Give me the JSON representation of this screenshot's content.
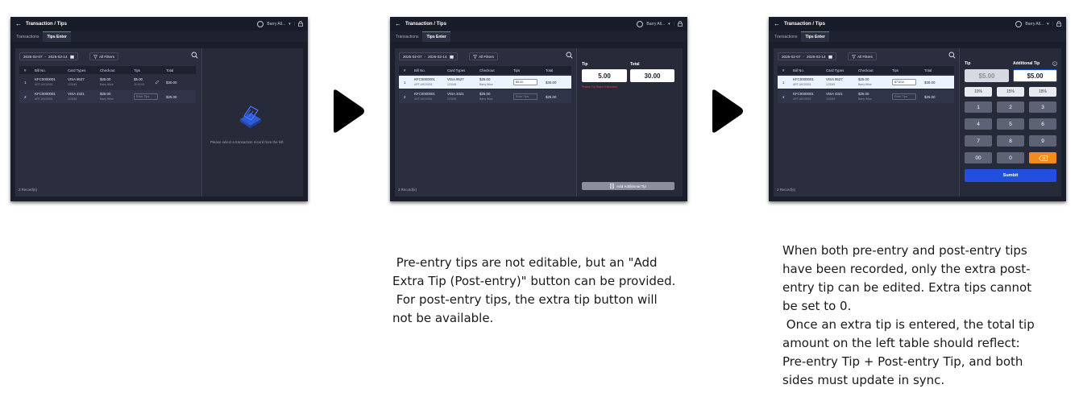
{
  "colors": {
    "accent": "#2150e0",
    "selected_row": "#ebf3ff",
    "error": "#e04545",
    "delete_key": "#f28c20",
    "frame_bg": "#1b1f2c"
  },
  "screens": [
    {
      "title": "Transaction / Tips",
      "user": "Barry All...",
      "tabs": [
        "Transactions",
        "Tips Enter"
      ],
      "date_from": "2025-02-07",
      "date_sep": "-",
      "date_to": "2025-02-14",
      "filter_label": "All Filters",
      "columns": [
        "#",
        "Bill No.",
        "Card Types",
        "Checkout",
        "Tips",
        "Total"
      ],
      "rows": [
        {
          "num": "1",
          "bill": "KFC0000001",
          "bill_sub": "ART-UKO0001",
          "card": "VISA 9527",
          "card_sub": "123245",
          "checkout": "$25.00",
          "checkout_sub": "Barry Wise",
          "tips": "$5.00",
          "tips_sub": "20:00.00",
          "tips_placeholder": "",
          "total": "$30.00"
        },
        {
          "num": "2",
          "bill": "KFC0000001",
          "bill_sub": "ART-UKO0001",
          "card": "VISA 4321",
          "card_sub": "123245",
          "checkout": "$25.00",
          "checkout_sub": "Barry Wise",
          "tips": "",
          "tips_sub": "",
          "tips_placeholder": "Enter Tips",
          "total": "$25.00"
        }
      ],
      "records": "2 Record(s)",
      "placeholder": "Please select a transaction record from the left",
      "icons": [
        "back-arrow-icon",
        "user-icon",
        "chevron-down-icon",
        "lock-icon",
        "calendar-icon",
        "filter-icon",
        "search-icon",
        "edit-icon",
        "empty-box-icon"
      ]
    },
    {
      "title": "Transaction / Tips",
      "user": "Barry All...",
      "tabs": [
        "Transactions",
        "Tips Enter"
      ],
      "date_from": "2025-02-07",
      "date_sep": "-",
      "date_to": "2025-02-14",
      "filter_label": "All Filters",
      "columns": [
        "#",
        "Bill No.",
        "Card Types",
        "Checkout",
        "Tips",
        "Total"
      ],
      "rows": [
        {
          "num": "1",
          "bill": "KFC0000001",
          "bill_sub": "ART-UKO0001",
          "card": "VISA 9527",
          "card_sub": "123245",
          "checkout": "$25.00",
          "checkout_sub": "Barry Wise",
          "tips": "$5.00",
          "tips_placeholder": "",
          "total": "$30.00"
        },
        {
          "num": "2",
          "bill": "KFC0000001",
          "bill_sub": "ART-UKO0001",
          "card": "VISA 4321",
          "card_sub": "123245",
          "checkout": "$25.00",
          "checkout_sub": "Barry Wise",
          "tips": "",
          "tips_placeholder": "Enter Tips",
          "total": "$25.00"
        }
      ],
      "records": "2 Record(s)",
      "tip_label": "Tip",
      "total_label": "Total",
      "tip_value": "5.00",
      "total_value": "30.00",
      "error_text": "Please Tip Warm Estimates",
      "add_tip_label": "Add Additional Tip",
      "icons": [
        "document-plus-icon"
      ]
    },
    {
      "title": "Transaction / Tips",
      "user": "Barry All...",
      "tabs": [
        "Transactions",
        "Tips Enter"
      ],
      "date_from": "2025-02-07",
      "date_sep": "-",
      "date_to": "2025-02-14",
      "filter_label": "All Filters",
      "columns": [
        "#",
        "Bill No.",
        "Card Types",
        "Checkout",
        "Tips",
        "Total"
      ],
      "rows": [
        {
          "num": "1",
          "bill": "KFC0000001",
          "bill_sub": "ART-UKO0001",
          "card": "VISA 9527",
          "card_sub": "123245",
          "checkout": "$25.00",
          "checkout_sub": "Barry Wise",
          "tips": "$7.5/10",
          "tips_placeholder": "",
          "total": "$30.00"
        },
        {
          "num": "2",
          "bill": "KFC0000001",
          "bill_sub": "ART-UKO0001",
          "card": "VISA 4321",
          "card_sub": "123245",
          "checkout": "$25.00",
          "checkout_sub": "Barry Wise",
          "tips": "",
          "tips_placeholder": "Enter Tips",
          "total": "$25.00"
        }
      ],
      "records": "2 Record(s)",
      "tip_label": "Tip",
      "additional_tip_label": "Additional Tip",
      "tip_value": "$5.00",
      "additional_tip_value": "$5.00",
      "percent_buttons": [
        "10%",
        "15%",
        "18%"
      ],
      "keys": [
        "1",
        "2",
        "3",
        "4",
        "5",
        "6",
        "7",
        "8",
        "9",
        "00",
        "0"
      ],
      "submit_label": "Sumbit",
      "icons": [
        "info-icon",
        "backspace-icon"
      ]
    }
  ],
  "captions": {
    "middle": " Pre-entry tips are not editable, but an \"Add\nExtra Tip (Post-entry)\" button can be provided.\n For post-entry tips, the extra tip button will\nnot be available.",
    "right": "When both pre-entry and post-entry tips\nhave been recorded, only the extra post-\nentry tip can be edited. Extra tips cannot\nbe set to 0.\n Once an extra tip is entered, the total tip\namount on the left table should reflect:\nPre-entry Tip + Post-entry Tip, and both\nsides must update in sync."
  }
}
